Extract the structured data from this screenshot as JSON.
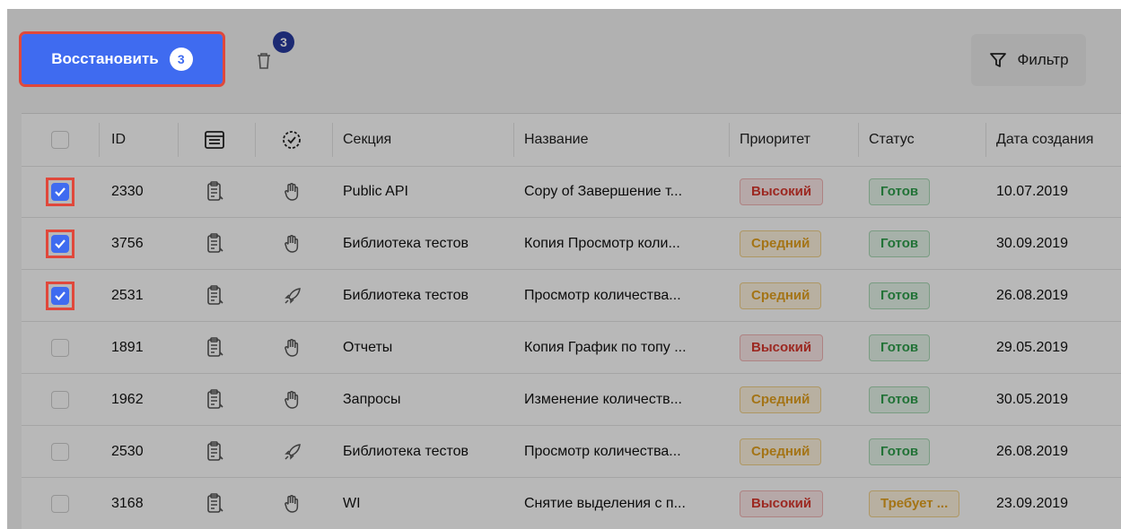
{
  "toolbar": {
    "restore_label": "Восстановить",
    "restore_count": "3",
    "trash_count": "3",
    "filter_label": "Фильтр"
  },
  "table": {
    "headers": {
      "id": "ID",
      "section": "Секция",
      "name": "Название",
      "priority": "Приоритет",
      "status": "Статус",
      "created": "Дата создания"
    },
    "rows": [
      {
        "checked": true,
        "id": "2330",
        "type_icon": "hand-icon",
        "section": "Public API",
        "name": "Copy of Завершение т...",
        "priority": "Высокий",
        "priority_level": "high",
        "status": "Готов",
        "status_level": "done",
        "created": "10.07.2019"
      },
      {
        "checked": true,
        "id": "3756",
        "type_icon": "hand-icon",
        "section": "Библиотека тестов",
        "name": "Копия Просмотр коли...",
        "priority": "Средний",
        "priority_level": "medium",
        "status": "Готов",
        "status_level": "done",
        "created": "30.09.2019"
      },
      {
        "checked": true,
        "id": "2531",
        "type_icon": "rocket-icon",
        "section": "Библиотека тестов",
        "name": "Просмотр количества...",
        "priority": "Средний",
        "priority_level": "medium",
        "status": "Готов",
        "status_level": "done",
        "created": "26.08.2019"
      },
      {
        "checked": false,
        "id": "1891",
        "type_icon": "hand-icon",
        "section": "Отчеты",
        "name": "Копия График по топу ...",
        "priority": "Высокий",
        "priority_level": "high",
        "status": "Готов",
        "status_level": "done",
        "created": "29.05.2019"
      },
      {
        "checked": false,
        "id": "1962",
        "type_icon": "hand-icon",
        "section": "Запросы",
        "name": "Изменение количеств...",
        "priority": "Средний",
        "priority_level": "medium",
        "status": "Готов",
        "status_level": "done",
        "created": "30.05.2019"
      },
      {
        "checked": false,
        "id": "2530",
        "type_icon": "rocket-icon",
        "section": "Библиотека тестов",
        "name": "Просмотр количества...",
        "priority": "Средний",
        "priority_level": "medium",
        "status": "Готов",
        "status_level": "done",
        "created": "26.08.2019"
      },
      {
        "checked": false,
        "id": "3168",
        "type_icon": "hand-icon",
        "section": "WI",
        "name": "Снятие выделения с п...",
        "priority": "Высокий",
        "priority_level": "high",
        "status": "Требует ...",
        "status_level": "req",
        "created": "23.09.2019"
      }
    ]
  }
}
